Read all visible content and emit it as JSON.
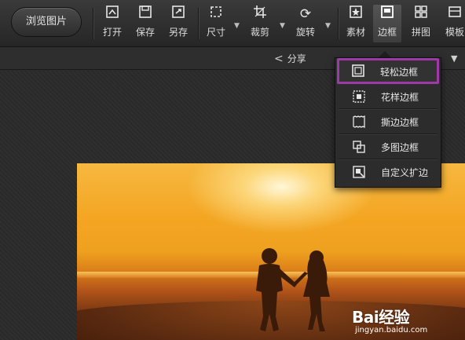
{
  "toolbar": {
    "browse_label": "浏览图片",
    "tools": [
      {
        "label": "打开",
        "icon": "open-icon"
      },
      {
        "label": "保存",
        "icon": "save-icon"
      },
      {
        "label": "另存",
        "icon": "save-as-icon"
      },
      {
        "label": "尺寸",
        "icon": "resize-icon"
      },
      {
        "label": "裁剪",
        "icon": "crop-icon"
      },
      {
        "label": "旋转",
        "icon": "rotate-icon"
      },
      {
        "label": "素材",
        "icon": "sticker-icon"
      },
      {
        "label": "边框",
        "icon": "frame-icon"
      },
      {
        "label": "拼图",
        "icon": "collage-icon"
      },
      {
        "label": "模板",
        "icon": "template-icon"
      }
    ],
    "active_tool": "边框"
  },
  "subbar": {
    "share_label": "分享"
  },
  "frame_menu": {
    "items": [
      {
        "label": "轻松边框",
        "icon": "simple-frame-icon",
        "selected": true
      },
      {
        "label": "花样边框",
        "icon": "pattern-frame-icon",
        "selected": false
      },
      {
        "label": "撕边边框",
        "icon": "torn-edge-frame-icon",
        "selected": false
      },
      {
        "label": "多图边框",
        "icon": "multi-image-frame-icon",
        "selected": false
      },
      {
        "label": "自定义扩边",
        "icon": "custom-extend-icon",
        "selected": false
      }
    ],
    "highlight_color": "#9d3aa8"
  },
  "watermark": {
    "brand": "Bai经验",
    "site": "jingyan.baidu.com"
  }
}
